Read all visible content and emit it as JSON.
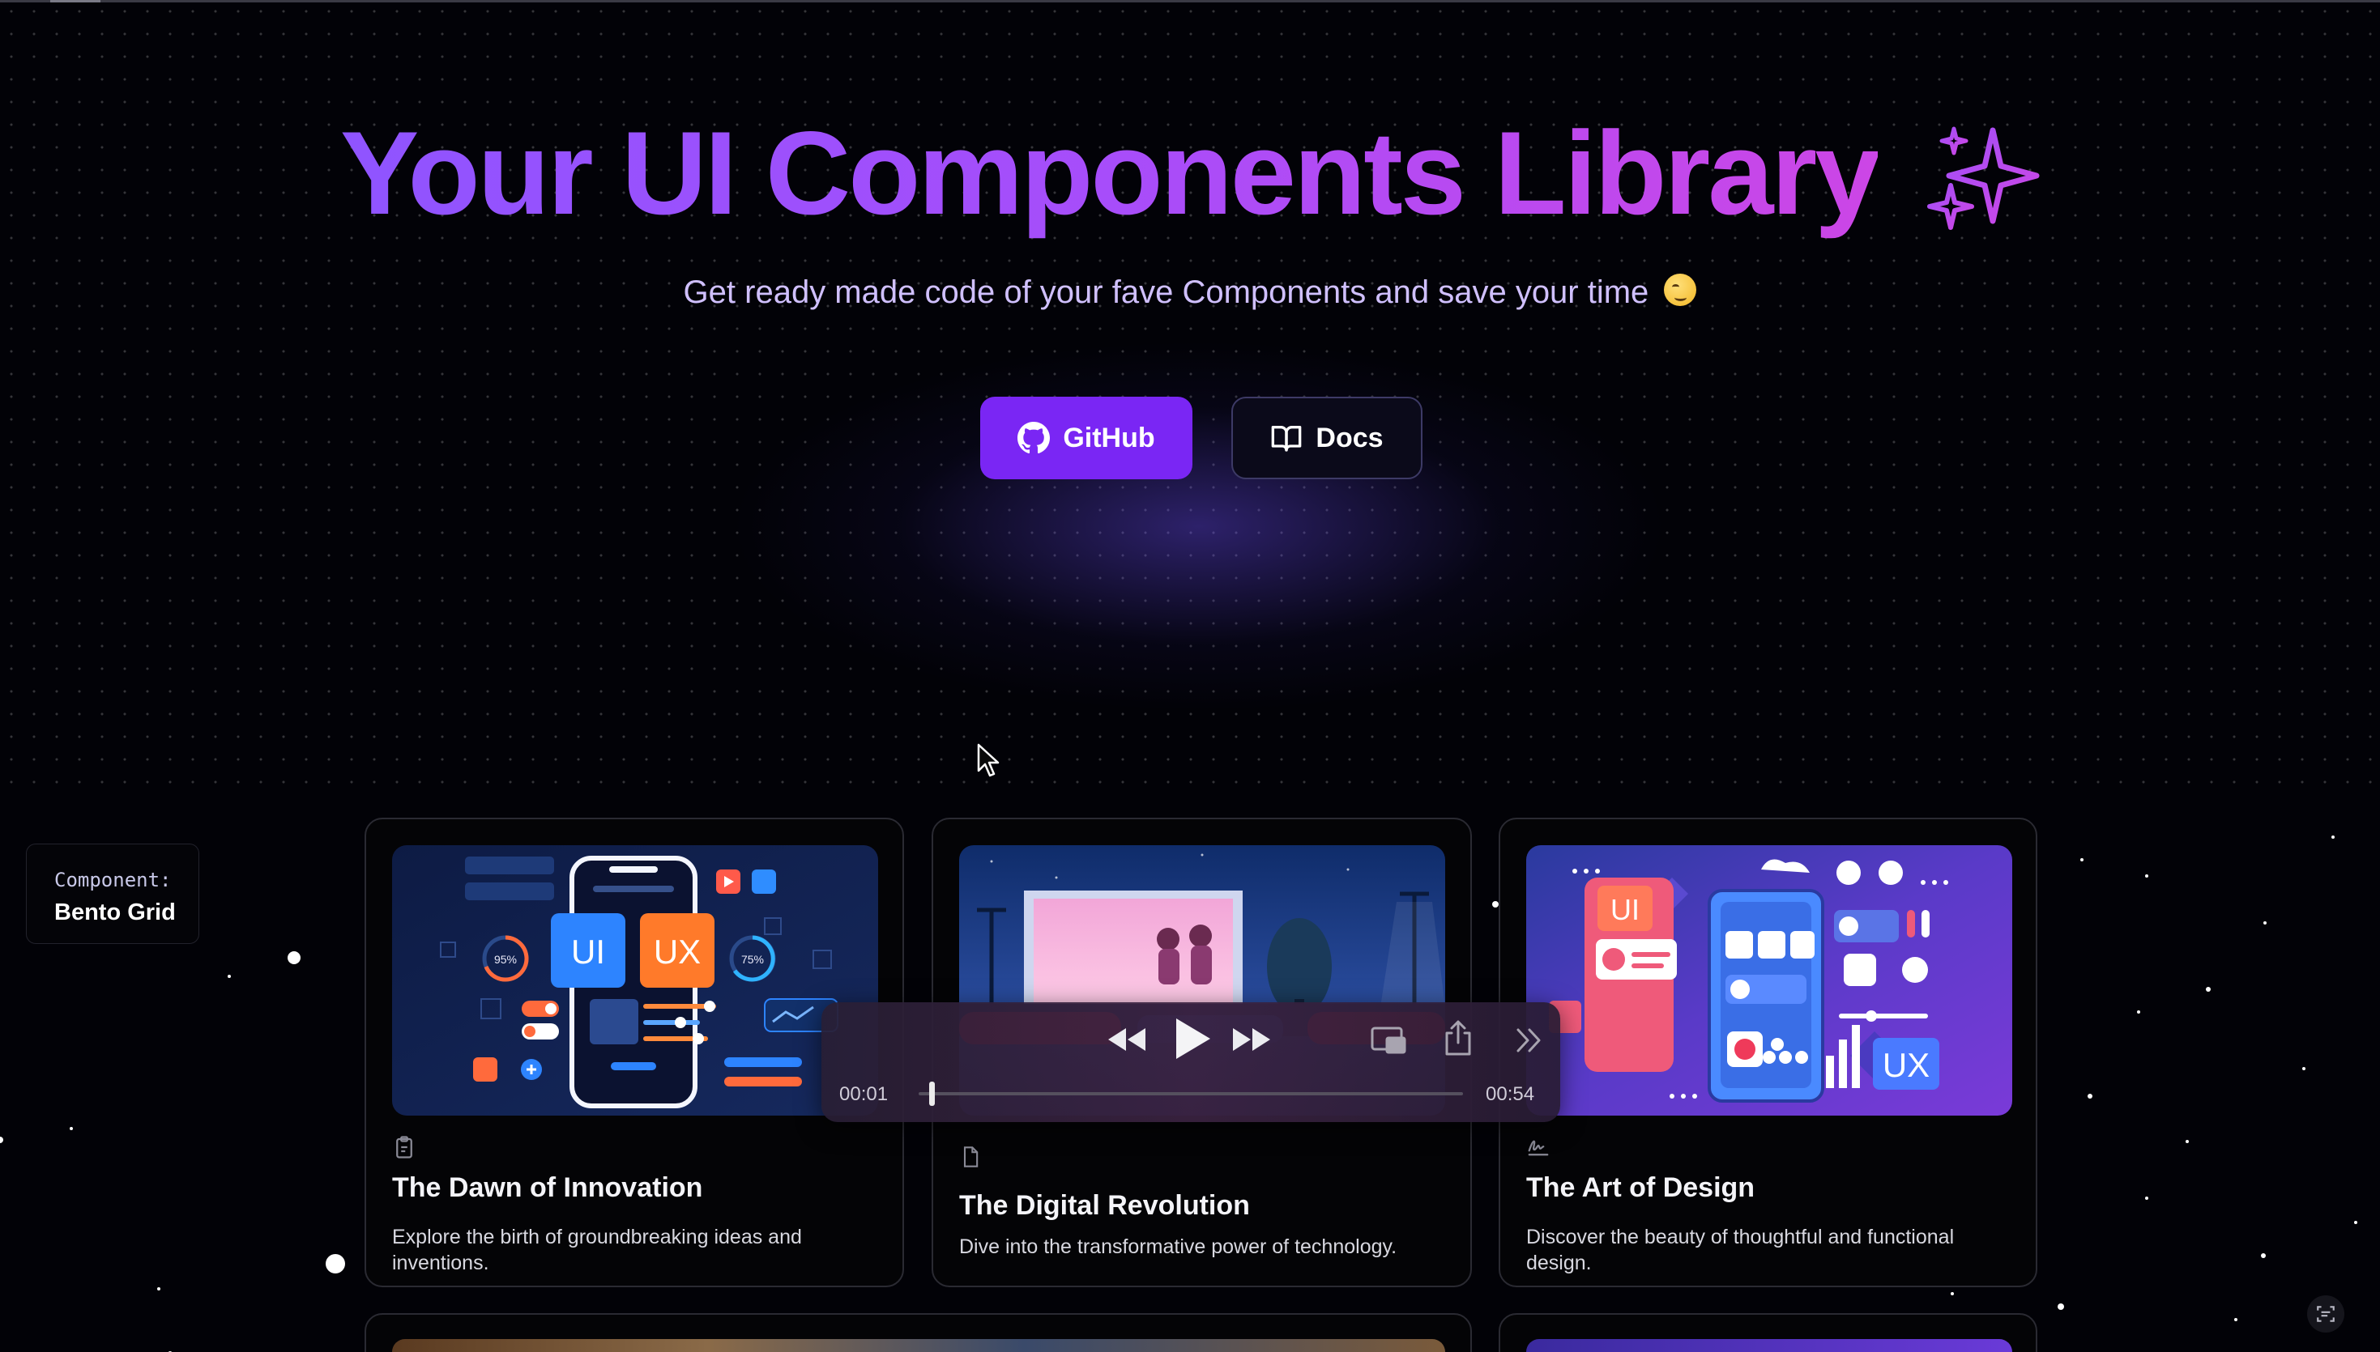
{
  "hero": {
    "title": "Your UI Components Library",
    "subtitle": "Get ready made code of your fave Components and save your time"
  },
  "buttons": {
    "github": "GitHub",
    "docs": "Docs"
  },
  "component_tag": {
    "label": "Component:",
    "value": "Bento Grid"
  },
  "cards": [
    {
      "title": "The Dawn of Innovation",
      "description": "Explore the birth of groundbreaking ideas and inventions.",
      "icon": "clipboard-icon"
    },
    {
      "title": "The Digital Revolution",
      "description": "Dive into the transformative power of technology.",
      "icon": "file-icon"
    },
    {
      "title": "The Art of Design",
      "description": "Discover the beauty of thoughtful and functional design.",
      "icon": "signature-icon"
    }
  ],
  "card_art": {
    "ui": "UI",
    "ux": "UX",
    "gauge_left": "95%",
    "gauge_right": "75%"
  },
  "player": {
    "current_time": "00:01",
    "duration": "00:54",
    "progress": 0.02
  },
  "colors": {
    "accent": "#7a26f4",
    "title_gradient_start": "#8f54ff",
    "title_gradient_end": "#cc46e6"
  }
}
